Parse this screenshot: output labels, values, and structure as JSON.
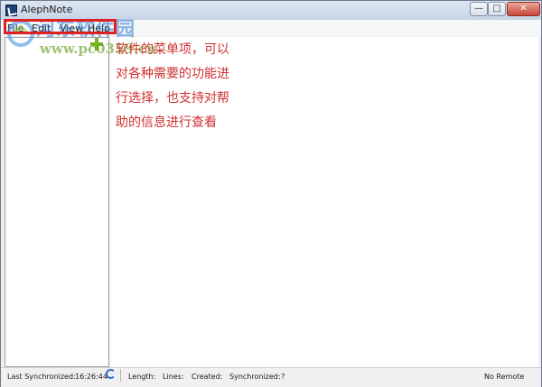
{
  "window": {
    "title": "AlephNote",
    "minimize_glyph": "—",
    "maximize_glyph": "□",
    "close_glyph": "✕"
  },
  "menu": {
    "items": [
      "File",
      "Edit",
      "View",
      "Help"
    ]
  },
  "annotation": {
    "lines": [
      "软件的菜单项，可以",
      "对各种需要的功能进",
      "行选择，也支持对帮",
      "助的信息进行查看"
    ]
  },
  "watermark": {
    "title": "河东软件园",
    "url": "www.pc0359.cn"
  },
  "statusbar": {
    "last_sync_label": "Last Synchronized:",
    "last_sync_time": "16:26:44",
    "length_label": "Length:",
    "lines_label": "Lines:",
    "created_label": "Created:",
    "synchronized_label": "Synchronized:",
    "synchronized_value": "?",
    "remote": "No Remote"
  },
  "icons": {
    "add": "add-note-icon",
    "sync": "sync-icon",
    "app": "app-icon"
  },
  "colors": {
    "annotation": "#d03030",
    "highlight_box": "#e02020",
    "add_icon": "#7ab51d"
  }
}
